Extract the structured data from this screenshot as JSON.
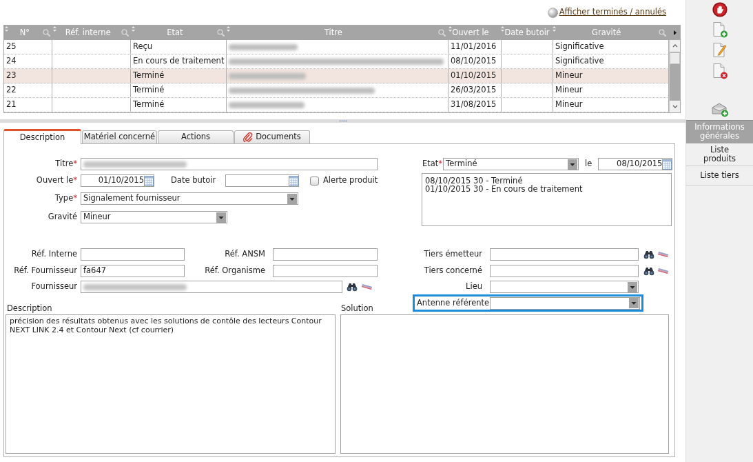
{
  "show_closed_link": {
    "label": "Afficher terminés / annulés"
  },
  "table": {
    "columns": [
      {
        "label": "N°",
        "searchable": true,
        "kind": "text"
      },
      {
        "label": "Réf. interne",
        "searchable": true,
        "kind": "text"
      },
      {
        "label": "Etat",
        "searchable": true,
        "kind": "text"
      },
      {
        "label": "Titre",
        "searchable": true,
        "kind": "blurred"
      },
      {
        "label": "Ouvert le",
        "searchable": false,
        "kind": "text"
      },
      {
        "label": "Date butoir",
        "searchable": false,
        "kind": "text"
      },
      {
        "label": "Gravité",
        "searchable": true,
        "kind": "text"
      }
    ],
    "rows": [
      {
        "selected": false,
        "cells": [
          "25",
          null,
          "Reçu",
          null,
          "11/01/2016",
          null,
          "Significative"
        ]
      },
      {
        "selected": false,
        "cells": [
          "24",
          null,
          "En cours de traitement",
          null,
          "08/10/2015",
          null,
          "Significative"
        ]
      },
      {
        "selected": true,
        "cells": [
          "23",
          null,
          "Terminé",
          null,
          "01/10/2015",
          null,
          "Mineur"
        ]
      },
      {
        "selected": false,
        "cells": [
          "22",
          null,
          "Terminé",
          null,
          "26/03/2015",
          null,
          "Mineur"
        ]
      },
      {
        "selected": false,
        "cells": [
          "21",
          null,
          "Terminé",
          null,
          "31/08/2015",
          null,
          "Mineur"
        ]
      }
    ]
  },
  "tabs": [
    {
      "label": "Description",
      "selected": true,
      "kind": "plain"
    },
    {
      "label": "Matériel concerné",
      "selected": false,
      "kind": "plain"
    },
    {
      "label": "Actions",
      "selected": false,
      "kind": "plain"
    },
    {
      "label": "Documents",
      "selected": false,
      "kind": "attachment"
    }
  ],
  "form": {
    "title": {
      "label": "Titre",
      "mark": "*",
      "blurred": true
    },
    "opened": {
      "label": "Ouvert le",
      "mark": "*",
      "value": "01/10/2015"
    },
    "deadline": {
      "label": "Date butoir"
    },
    "product_alert": {
      "label": "Alerte produit",
      "checked": false
    },
    "type": {
      "label": "Type",
      "mark": "*",
      "value": "Signalement fournisseur"
    },
    "severity": {
      "label": "Gravité",
      "value": "Mineur"
    },
    "internal_ref": {
      "label": "Réf. Interne"
    },
    "ansm_ref": {
      "label": "Réf. ANSM"
    },
    "supplier_ref": {
      "label": "Réf. Fournisseur",
      "value": "fa647"
    },
    "organism_ref": {
      "label": "Réf. Organisme"
    },
    "supplier": {
      "label": "Fournisseur",
      "blurred": true
    },
    "status": {
      "label": "Etat",
      "mark": "*",
      "value": "Terminé"
    },
    "status_date": {
      "label": "le",
      "value": "08/10/2015"
    },
    "history": [
      "08/10/2015 30 - Terminé",
      "01/10/2015 30 - En cours de traitement"
    ],
    "issuer": {
      "label": "Tiers émetteur"
    },
    "concerned": {
      "label": "Tiers concerné"
    },
    "place": {
      "label": "Lieu"
    },
    "branch": {
      "label": "Antenne référente",
      "focused": true
    },
    "description": {
      "label": "Description",
      "value": "précision des résultats obtenus avec les solutions de contôle des lecteurs Contour NEXT LINK 2.4 et Contour Next (cf courrier)"
    },
    "solution": {
      "label": "Solution"
    }
  },
  "sidebar": {
    "menu": [
      {
        "label": "Informations générales",
        "selected": true
      },
      {
        "label": "Liste produits",
        "selected": false
      },
      {
        "label": "Liste tiers",
        "selected": false
      }
    ]
  }
}
